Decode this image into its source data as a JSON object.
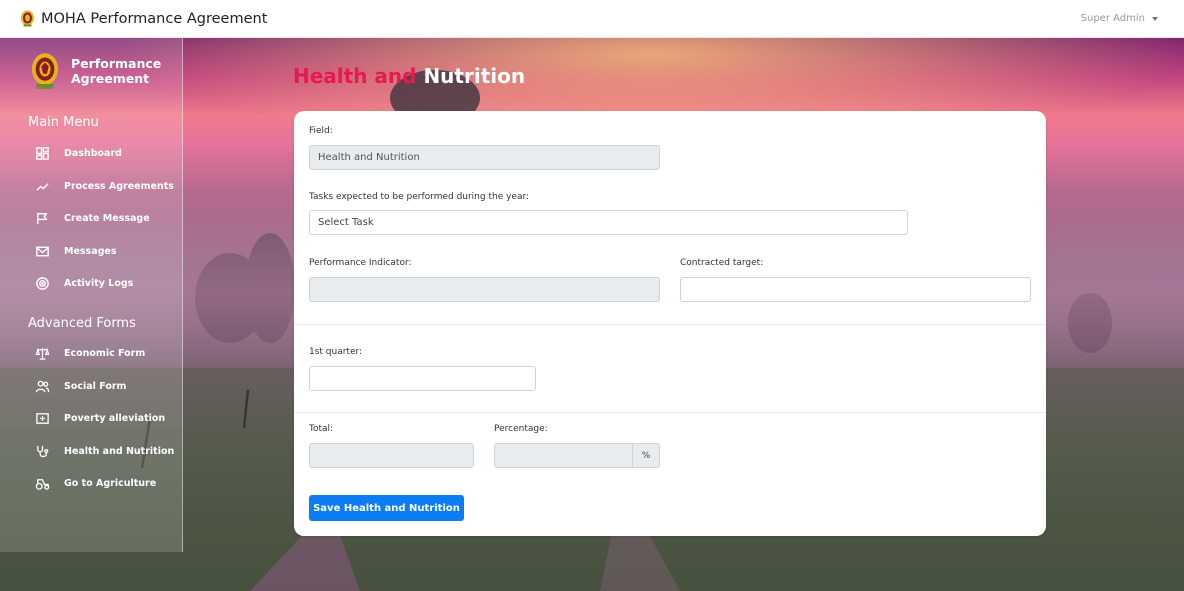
{
  "navbar": {
    "title": "MOHA Performance Agreement",
    "user": "Super Admin"
  },
  "sidebar": {
    "brand": "Performance Agreement",
    "main_menu_title": "Main Menu",
    "main_menu": [
      {
        "label": "Dashboard",
        "icon": "dashboard-icon"
      },
      {
        "label": "Process Agreements",
        "icon": "trend-icon"
      },
      {
        "label": "Create Message",
        "icon": "flag-icon"
      },
      {
        "label": "Messages",
        "icon": "mail-icon"
      },
      {
        "label": "Activity Logs",
        "icon": "target-icon"
      }
    ],
    "advanced_title": "Advanced Forms",
    "advanced_menu": [
      {
        "label": "Economic Form",
        "icon": "scales-icon"
      },
      {
        "label": "Social Form",
        "icon": "users-icon"
      },
      {
        "label": "Poverty alleviation",
        "icon": "money-icon"
      },
      {
        "label": "Health and Nutrition",
        "icon": "stethoscope-icon"
      },
      {
        "label": "Go to Agriculture",
        "icon": "tractor-icon"
      }
    ]
  },
  "page": {
    "title_part1": "Health and",
    "title_part2": "Nutrition"
  },
  "form": {
    "field_label": "Field:",
    "field_value": "Health and Nutrition",
    "tasks_label": "Tasks expected to be performed during the year:",
    "tasks_value": "Select Task",
    "indicator_label": "Performance Indicator:",
    "indicator_value": "",
    "target_label": "Contracted target:",
    "target_value": "",
    "quarter_label": "1st quarter:",
    "quarter_value": "",
    "total_label": "Total:",
    "total_value": "",
    "percentage_label": "Percentage:",
    "percentage_value": "",
    "percentage_suffix": "%",
    "save_label": "Save Health and Nutrition"
  },
  "colors": {
    "title_accent": "#e8194e",
    "button": "#0d7df5"
  }
}
